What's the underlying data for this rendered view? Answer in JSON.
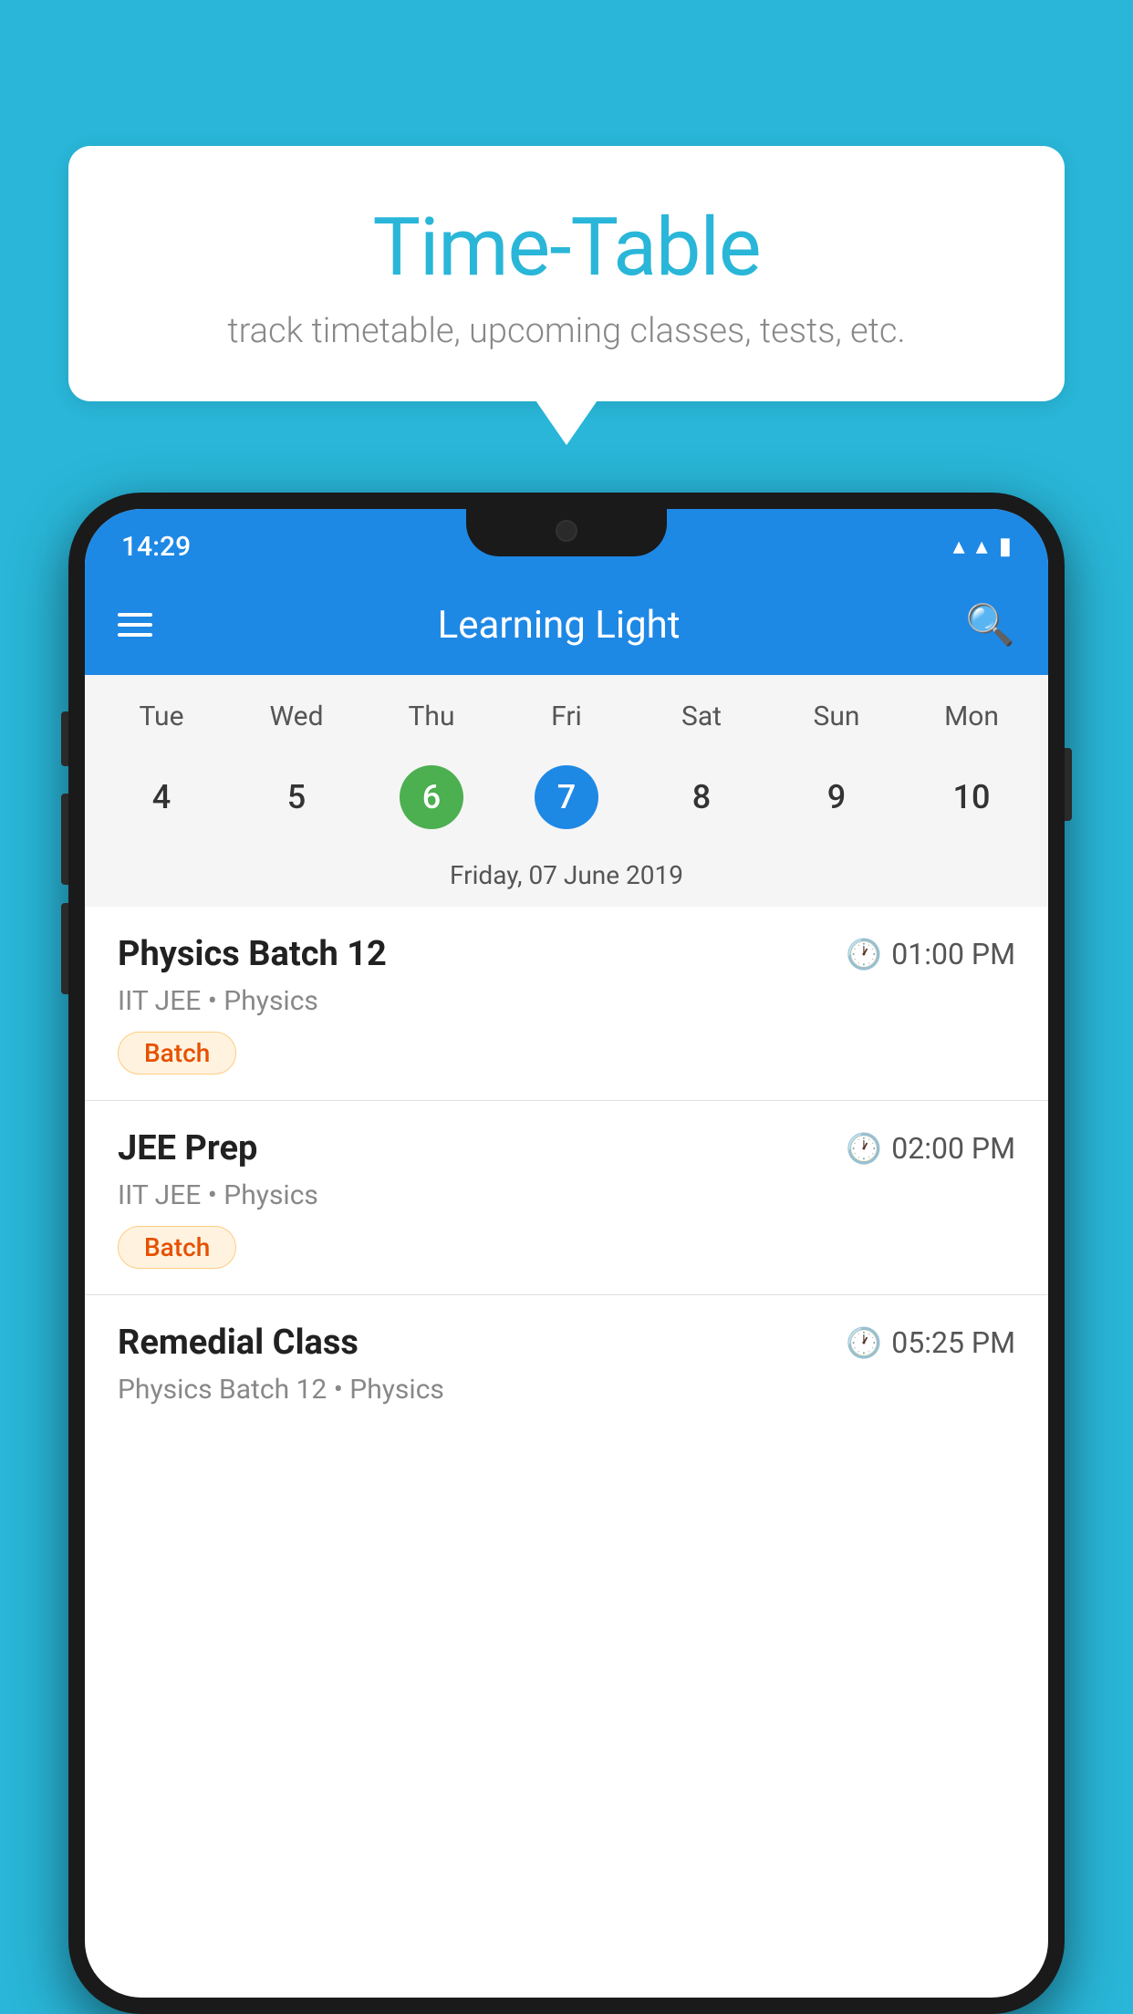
{
  "background_color": "#29b6d8",
  "speech_bubble": {
    "title": "Time-Table",
    "subtitle": "track timetable, upcoming classes, tests, etc."
  },
  "status_bar": {
    "time": "14:29"
  },
  "app_bar": {
    "title": "Learning Light"
  },
  "calendar": {
    "days": [
      "Tue",
      "Wed",
      "Thu",
      "Fri",
      "Sat",
      "Sun",
      "Mon"
    ],
    "dates": [
      "4",
      "5",
      "6",
      "7",
      "8",
      "9",
      "10"
    ],
    "today_index": 2,
    "selected_index": 3,
    "selected_label": "Friday, 07 June 2019"
  },
  "schedule": [
    {
      "title": "Physics Batch 12",
      "time": "01:00 PM",
      "subtitle": "IIT JEE • Physics",
      "tag": "Batch"
    },
    {
      "title": "JEE Prep",
      "time": "02:00 PM",
      "subtitle": "IIT JEE • Physics",
      "tag": "Batch"
    },
    {
      "title": "Remedial Class",
      "time": "05:25 PM",
      "subtitle": "Physics Batch 12 • Physics",
      "tag": ""
    }
  ]
}
